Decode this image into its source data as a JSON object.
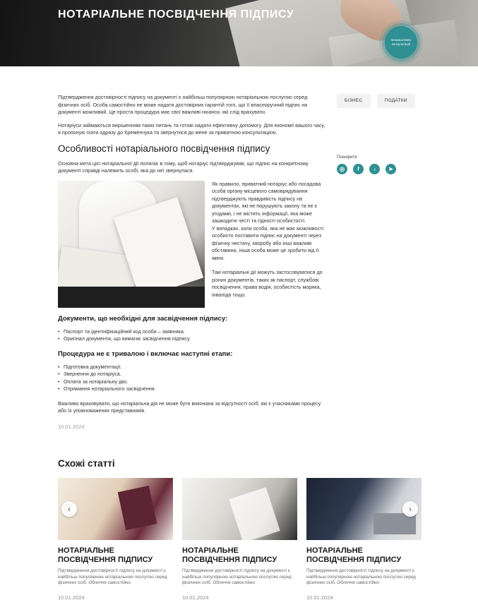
{
  "hero": {
    "title": "НОТАРІАЛЬНЕ ПОСВІДЧЕННЯ ПІДПИСУ",
    "badge_text": "Безкоштовна консультація"
  },
  "article": {
    "intro1": "Підтвердження достовірності підпису на документі є найбільш популярною нотаріальною послугою серед фізичних осіб. Особа самостійно не може надати достовірних гарантій того, що її власноручний підпис на документі можливий. Це проста процедура має свої важливі нюанси, які слід врахувати.",
    "intro2": "Нотаріуси займаються вирішенням таких питань та готові надати ефективну допомогу. Для економії вашого часу, я пропоную їхати одразу до Кременчука та звернутися до мене за приватною консультацією.",
    "section_title": "Особливості нотаріального посвідчення підпису",
    "section_intro": "Основна мета цієї нотаріальної дії полягає в тому, щоб нотаріус підтверджував, що підпис на конкретному документі справді належить особі, яка до неї звернулася.",
    "media_text1": "Як правило, приватний нотаріус або посадова особа органу місцевого самоврядування підтверджують правдивість підпису на документах, які не порушують закону та не є угодами, і не містять інформації, яка може зашкодити честі та гідності особистості.",
    "media_text2": "У випадках, коли особа, яка не має можливості особисто поставити підпис на документі через фізичну нестачу, хворобу або інші важливі обставини, інша особа може це зробити від її імені.",
    "media_text3": "Такі нотаріальні дії можуть застосовуватися до різних документів, таких як паспорт, службові посвідчення, права водія, особистість моряка, інваліда тощо.",
    "docs_title": "Документи, що необхідні для засвідчення підпису:",
    "docs": [
      "Паспорт та ідентифікаційний код особи – заявника.",
      "Оригінал документа, що вимагає засвідчення підпису."
    ],
    "steps_title": "Процедура не є тривалою і включає наступні етапи:",
    "steps": [
      "Підготовка документації.",
      "Звернення до нотаріуса.",
      "Оплата за нотаріальну дію.",
      "Отримання нотаріального засвідчення."
    ],
    "closing": "Важливо враховувати, що нотаріальна дія не може бути виконана за відсутності осіб, які є учасниками процесу або їх уповноважених представників.",
    "date": "10.01.2024"
  },
  "sidebar": {
    "tags": [
      "БІЗНЕС",
      "ПОДАТКИ"
    ],
    "share_label": "Поширити",
    "socials": [
      {
        "icon": "instagram-icon",
        "glyph": "◎"
      },
      {
        "icon": "facebook-icon",
        "glyph": "f"
      },
      {
        "icon": "tiktok-icon",
        "glyph": "♪"
      },
      {
        "icon": "telegram-icon",
        "glyph": "➤"
      }
    ]
  },
  "related": {
    "title": "Схожі статті",
    "cards": [
      {
        "title": "НОТАРІАЛЬНЕ ПОСВІДЧЕННЯ ПІДПИСУ",
        "excerpt": "Підтвердження достовірності підпису на документі є найбільш популярною нотаріальною послугою серед фізичних осіб. Обличчя самостійно",
        "date": "10.01.2024"
      },
      {
        "title": "НОТАРІАЛЬНЕ ПОСВІДЧЕННЯ ПІДПИСУ",
        "excerpt": "Підтвердження достовірності підпису на документі є найбільш популярною нотаріальною послугою серед фізичних осіб. Обличчя самостійно",
        "date": "10.01.2024"
      },
      {
        "title": "НОТАРІАЛЬНЕ ПОСВІДЧЕННЯ ПІДПИСУ",
        "excerpt": "Підтвердження достовірності підпису на документі є найбільш популярною нотаріальною послугою серед фізичних осіб. Обличчя самостійно",
        "date": "10.01.2024"
      }
    ],
    "prev_glyph": "‹",
    "next_glyph": "›"
  },
  "colors": {
    "accent": "#2f8f93"
  }
}
